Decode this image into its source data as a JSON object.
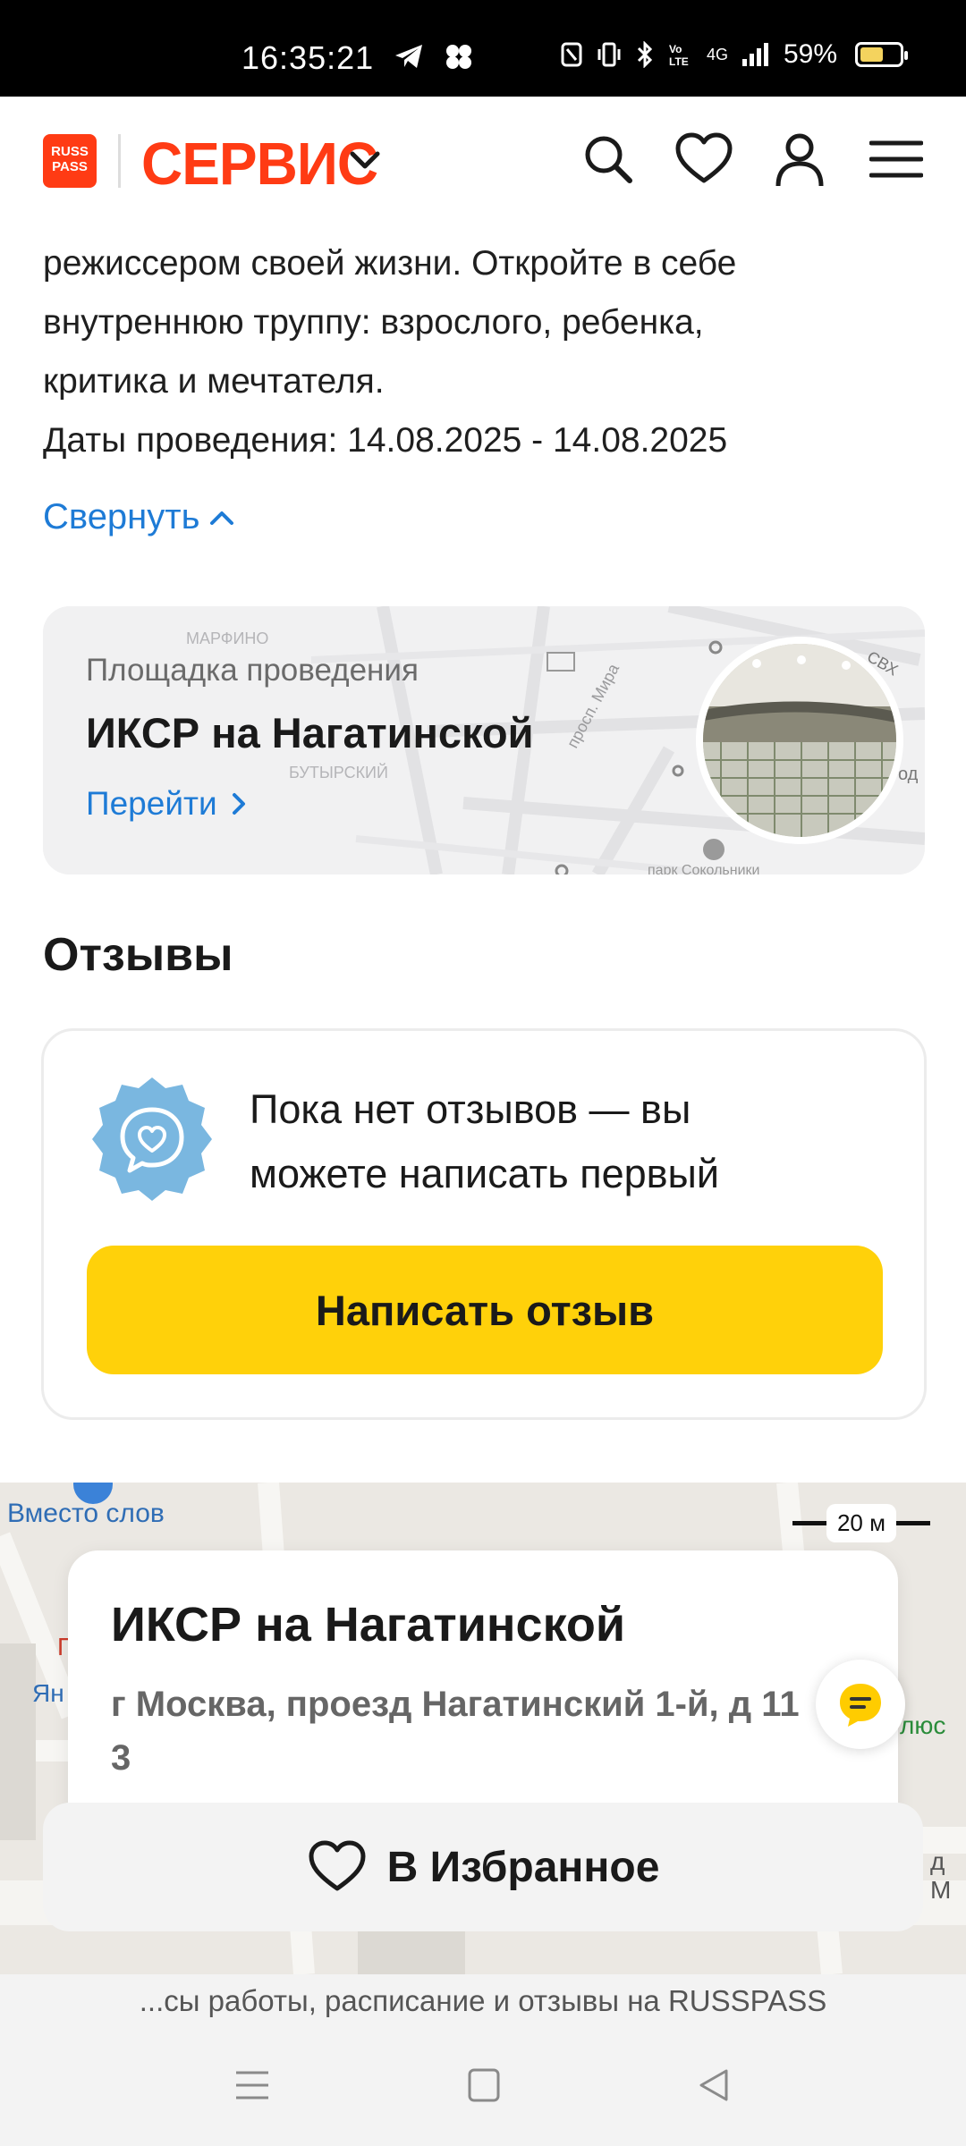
{
  "status_bar": {
    "time": "16:35:21",
    "battery": "59%",
    "battery_level": 0.59,
    "network": "4G"
  },
  "header": {
    "logo_text": "RUSS PASS",
    "brand": "СЕРВИС"
  },
  "description": {
    "line1": "режиссером своей жизни. Откройте в себе",
    "line2": "внутреннюю труппу: взрослого, ребенка,",
    "line3": "критика и мечтателя.",
    "dates": "Даты проведения: 14.08.2025 - 14.08.2025",
    "collapse_label": "Свернуть"
  },
  "venue": {
    "label": "Площадка проведения",
    "name": "ИКСР на Нагатинской",
    "go_label": "Перейти",
    "map_labels": [
      "МАРФИНО",
      "БУТЫРСКИЙ",
      "просп. Мира",
      "СВХ",
      "од",
      "парк Сокольники"
    ]
  },
  "reviews": {
    "title": "Отзывы",
    "empty_line1": "Пока нет отзывов — вы",
    "empty_line2": "можете написать первый",
    "write_button": "Написать отзыв"
  },
  "map": {
    "poi_label": "Вместо слов",
    "scale": "20 м",
    "side_labels": [
      "Ян",
      "П",
      "люс",
      "д М"
    ]
  },
  "address_card": {
    "name": "ИКСР на Нагатинской",
    "address_line1": "г Москва, проезд Нагатинский 1-й, д 11",
    "address_line2": "3"
  },
  "favorite_button": "В Избранное",
  "browser_bar_text": "...сы работы, расписание и отзывы на RUSSPASS",
  "colors": {
    "brand": "#ff3b14",
    "link": "#1e7bd6",
    "primary_button": "#ffd10a",
    "review_badge": "#7ab7e0"
  }
}
